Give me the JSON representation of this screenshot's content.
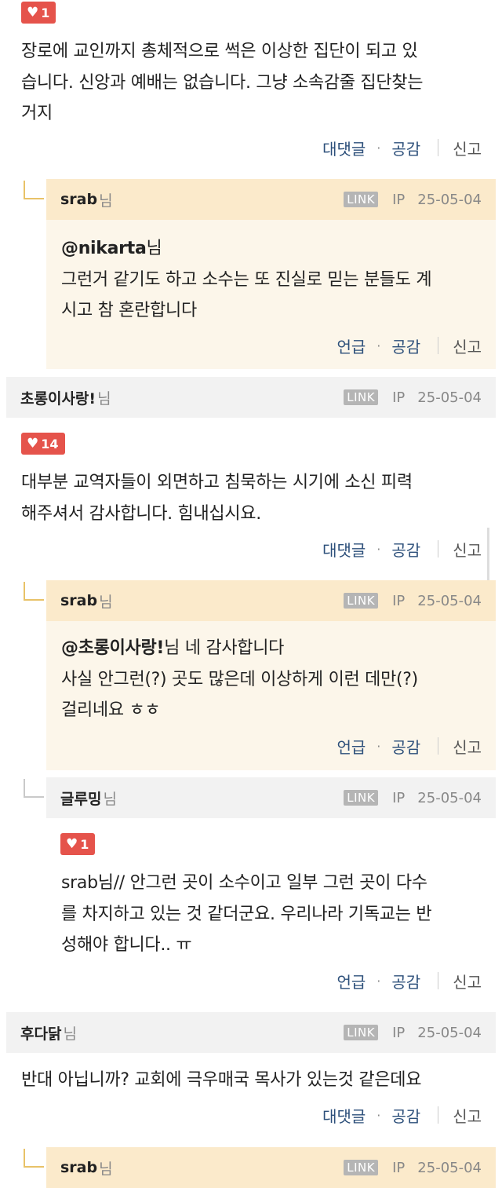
{
  "comments": [
    {
      "likes": "1",
      "lines": [
        "장로에 교인까지 총체적으로 썩은 이상한 집단이 되고 있",
        "습니다. 신앙과 예배는 없습니다. 그냥 소속감줄 집단찾는",
        "거지"
      ],
      "actions": {
        "reply": "대댓글",
        "empathy": "공감",
        "report": "신고"
      }
    },
    {
      "user": "srab",
      "nim": "님",
      "link": "LINK",
      "ip": "IP",
      "date": "25-05-04",
      "mention": "@nikarta",
      "mention_suffix": "님",
      "lines": [
        "그런거 같기도 하고 소수는 또 진실로 믿는 분들도 계",
        "시고 참 혼란합니다"
      ],
      "actions": {
        "reply": "언급",
        "empathy": "공감",
        "report": "신고"
      }
    },
    {
      "user": "초롱이사랑!",
      "nim": "님",
      "link": "LINK",
      "ip": "IP",
      "date": "25-05-04",
      "likes": "14",
      "lines": [
        "대부분 교역자들이 외면하고 침묵하는 시기에 소신 피력",
        "해주셔서 감사합니다. 힘내십시요."
      ],
      "actions": {
        "reply": "대댓글",
        "empathy": "공감",
        "report": "신고"
      }
    },
    {
      "user": "srab",
      "nim": "님",
      "link": "LINK",
      "ip": "IP",
      "date": "25-05-04",
      "mention": "@초롱이사랑!",
      "mention_suffix": "님 네 감사합니다",
      "lines": [
        "사실 안그런(?) 곳도 많은데 이상하게 이런 데만(?)",
        "걸리네요 ㅎㅎ"
      ],
      "actions": {
        "reply": "언급",
        "empathy": "공감",
        "report": "신고"
      }
    },
    {
      "user": "글루밍",
      "nim": "님",
      "link": "LINK",
      "ip": "IP",
      "date": "25-05-04",
      "likes": "1",
      "lines": [
        "srab님// 안그런 곳이 소수이고 일부 그런 곳이 다수",
        "를 차지하고 있는 것 같더군요. 우리나라 기독교는 반",
        "성해야 합니다.. ㅠ"
      ],
      "actions": {
        "reply": "언급",
        "empathy": "공감",
        "report": "신고"
      }
    },
    {
      "user": "후다닭",
      "nim": "님",
      "link": "LINK",
      "ip": "IP",
      "date": "25-05-04",
      "lines": [
        "반대 아닙니까? 교회에 극우매국 목사가 있는것 같은데요"
      ],
      "actions": {
        "reply": "대댓글",
        "empathy": "공감",
        "report": "신고"
      }
    },
    {
      "user": "srab",
      "nim": "님",
      "link": "LINK",
      "ip": "IP",
      "date": "25-05-04"
    }
  ],
  "colors": {
    "like_badge": "#e5534b",
    "reply_bg": "#fcf6ea",
    "reply_head": "#fbeacb",
    "head_gray": "#f2f2f2",
    "action_link": "#2c4f7a"
  }
}
